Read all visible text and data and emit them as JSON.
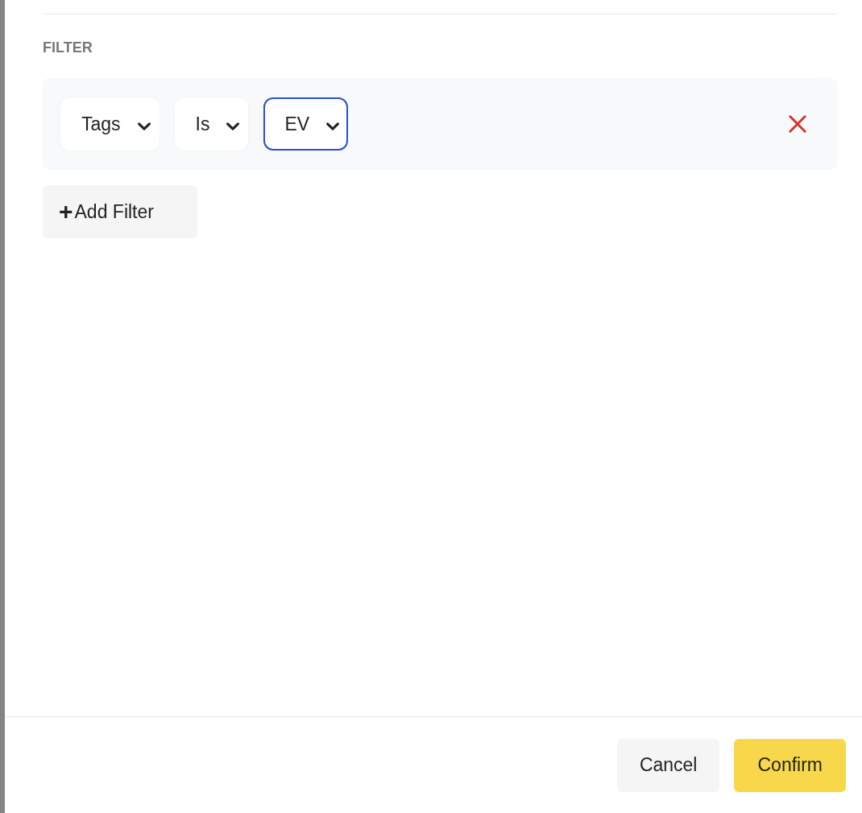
{
  "section_title": "FILTER",
  "filters": [
    {
      "dropdowns": [
        {
          "value": "Tags",
          "focused": false
        },
        {
          "value": "Is",
          "focused": false
        },
        {
          "value": "EV",
          "focused": true
        }
      ]
    }
  ],
  "add_filter": {
    "icon": "+",
    "label": "Add Filter"
  },
  "buttons": [
    {
      "label": "Cancel",
      "kind": "secondary"
    },
    {
      "label": "Confirm",
      "kind": "primary"
    }
  ]
}
